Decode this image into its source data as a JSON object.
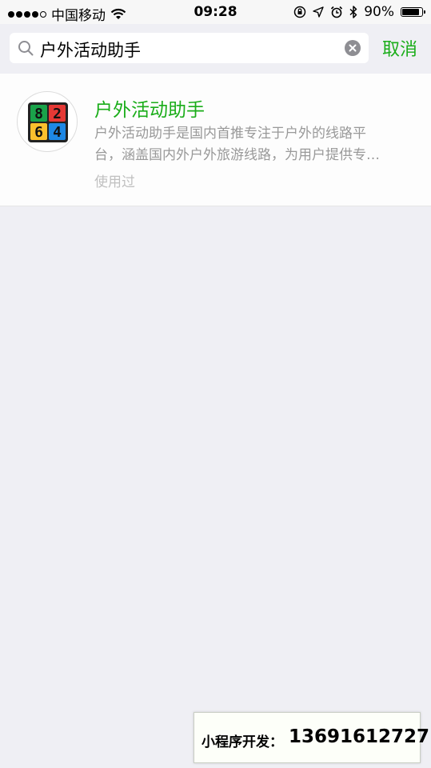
{
  "status_bar": {
    "carrier": "中国移动",
    "time": "09:28",
    "battery": "90%",
    "battery_level": 0.9
  },
  "search": {
    "query": "户外活动助手",
    "cancel_label": "取消"
  },
  "result": {
    "title": "户外活动助手",
    "description_line1": "户外活动助手是国内首推专注于户外的线路平",
    "description_line2": "台，涵盖国内外户外旅游线路，为用户提供专…",
    "used_label": "使用过",
    "icon_digits": [
      "8",
      "2",
      "6",
      "4"
    ],
    "icon_colors": [
      "#1aa34a",
      "#e53935",
      "#fbc02d",
      "#1e88e5"
    ]
  },
  "footer": {
    "label": "小程序开发：",
    "phone": "13691612727"
  },
  "colors": {
    "accent": "#1aad19",
    "background": "#efeff4"
  }
}
